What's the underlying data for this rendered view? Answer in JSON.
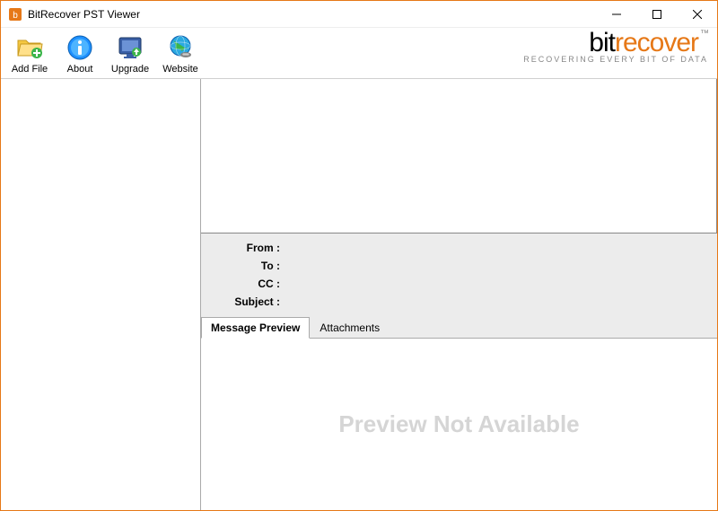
{
  "window": {
    "title": "BitRecover PST Viewer"
  },
  "toolbar": {
    "addfile_label": "Add File",
    "about_label": "About",
    "upgrade_label": "Upgrade",
    "website_label": "Website"
  },
  "brand": {
    "bit": "bit",
    "recover": "recover",
    "tm": "™",
    "tagline": "RECOVERING EVERY BIT OF DATA"
  },
  "headers": {
    "from_label": "From :",
    "to_label": "To :",
    "cc_label": "CC :",
    "subject_label": "Subject :",
    "from_value": "",
    "to_value": "",
    "cc_value": "",
    "subject_value": ""
  },
  "tabs": {
    "message_preview": "Message Preview",
    "attachments": "Attachments"
  },
  "preview": {
    "placeholder": "Preview Not Available"
  },
  "icons": {
    "app": "app-icon",
    "addfile": "folder-add-icon",
    "about": "info-icon",
    "upgrade": "upgrade-icon",
    "website": "globe-icon"
  }
}
